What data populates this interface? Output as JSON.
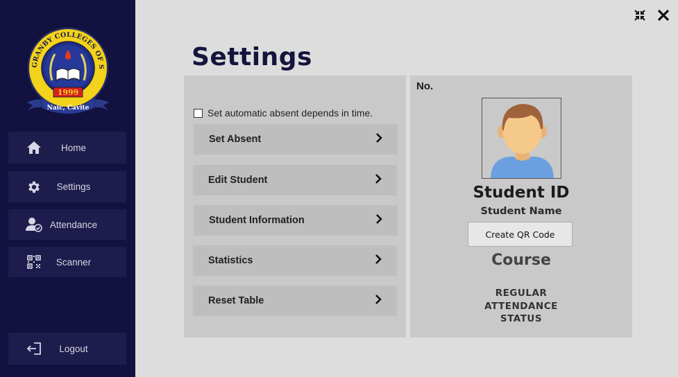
{
  "sidebar": {
    "logo": {
      "ring_text": "GRANBY COLLEGES OF SCIENCE AND TECHNOLOGY",
      "year": "1999",
      "ribbon": "Naic, Cavite"
    },
    "items": [
      {
        "label": "Home",
        "icon": "home-icon"
      },
      {
        "label": "Settings",
        "icon": "gear-icon"
      },
      {
        "label": "Attendance",
        "icon": "user-check-icon"
      },
      {
        "label": "Scanner",
        "icon": "qr-icon"
      }
    ],
    "logout": {
      "label": "Logout",
      "icon": "logout-icon"
    }
  },
  "window": {
    "minimize_icon": "collapse-icon",
    "close_icon": "close-icon"
  },
  "main": {
    "title": "Settings",
    "auto_absent_label": "Set automatic absent depends in time.",
    "auto_absent_checked": false,
    "options": [
      {
        "label": "Set Absent"
      },
      {
        "label": "Edit Student"
      },
      {
        "label": "Student Information"
      },
      {
        "label": "Statistics"
      },
      {
        "label": "Reset Table"
      }
    ]
  },
  "card": {
    "no_label": "No.",
    "student_id": "Student ID",
    "student_name": "Student Name",
    "qr_button": "Create QR Code",
    "course": "Course",
    "status_lines": [
      "REGULAR",
      "ATTENDANCE",
      "STATUS"
    ]
  },
  "colors": {
    "sidebar": "#12113f",
    "nav_item": "#1d1c4c",
    "panel": "#c9c9c9",
    "option": "#bebebe",
    "title": "#15143c"
  }
}
